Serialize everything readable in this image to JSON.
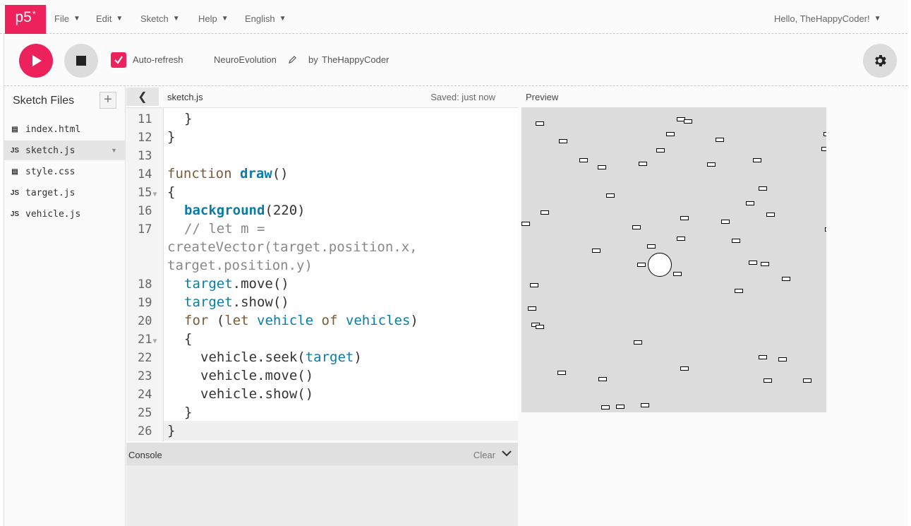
{
  "nav": {
    "logo": "p5",
    "logo_sup": "*",
    "menus": [
      "File",
      "Edit",
      "Sketch",
      "Help",
      "English"
    ],
    "user_greeting": "Hello, TheHappyCoder!"
  },
  "toolbar": {
    "auto_refresh_label": "Auto-refresh",
    "auto_refresh_checked": true,
    "sketch_name": "NeuroEvolution",
    "by_label": "by",
    "author": "TheHappyCoder"
  },
  "sidebar": {
    "title": "Sketch Files",
    "files": [
      {
        "name": "index.html",
        "type": "html"
      },
      {
        "name": "sketch.js",
        "type": "js",
        "selected": true
      },
      {
        "name": "style.css",
        "type": "css"
      },
      {
        "name": "target.js",
        "type": "js"
      },
      {
        "name": "vehicle.js",
        "type": "js"
      }
    ]
  },
  "editor": {
    "filename": "sketch.js",
    "saved_status": "Saved: just now",
    "line_numbers": [
      "11",
      "12",
      "13",
      "14",
      "15",
      "16",
      "17",
      "18",
      "19",
      "20",
      "21",
      "22",
      "23",
      "24",
      "25",
      "26"
    ],
    "lines": {
      "l11": "}",
      "l12": "}",
      "l14_kw": "function",
      "l14_fn": "draw",
      "l14_rest": "()",
      "l15": "{",
      "l16_fn": "background",
      "l16_rest": "(220)",
      "l17a": "// let m =",
      "l17b": "createVector(target.position.x,",
      "l17c": "target.position.y)",
      "l18_var": "target",
      "l18_rest": ".move()",
      "l19_var": "target",
      "l19_rest": ".show()",
      "l20_kw1": "for",
      "l20_p1": "(",
      "l20_kw2": "let",
      "l20_var1": "vehicle",
      "l20_kw3": "of",
      "l20_var2": "vehicles",
      "l20_p2": ")",
      "l21": "{",
      "l22_a": "vehicle.seek(",
      "l22_var": "target",
      "l22_b": ")",
      "l23": "vehicle.move()",
      "l24": "vehicle.show()",
      "l25": "}",
      "l26": "}"
    }
  },
  "console": {
    "title": "Console",
    "clear_label": "Clear"
  },
  "preview": {
    "title": "Preview",
    "background": "#dcdcdc"
  },
  "colors": {
    "accent": "#ed225d"
  },
  "icons": {
    "play": "play-icon",
    "stop": "stop-icon",
    "settings": "gear-icon",
    "edit": "pencil-icon",
    "collapse": "chevron-left-icon"
  }
}
